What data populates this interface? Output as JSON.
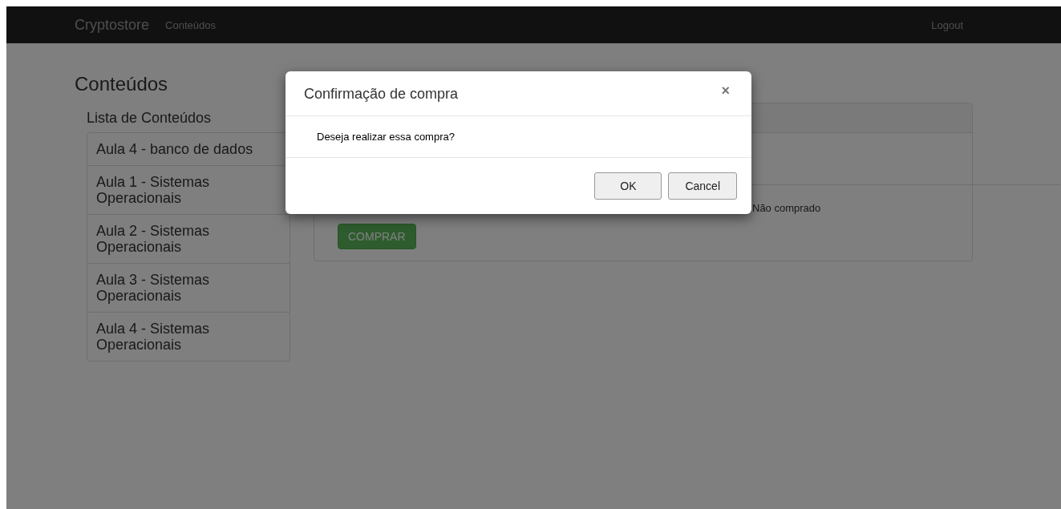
{
  "navbar": {
    "brand": "Cryptostore",
    "links": [
      {
        "label": "Conteúdos"
      }
    ],
    "logout": "Logout"
  },
  "page": {
    "title": "Conteúdos",
    "list_title": "Lista de Conteúdos",
    "items": [
      {
        "label": "Aula 4 - banco de dados"
      },
      {
        "label": "Aula 1 - Sistemas Operacionais"
      },
      {
        "label": "Aula 2 - Sistemas Operacionais"
      },
      {
        "label": "Aula 3 - Sistemas Operacionais"
      },
      {
        "label": "Aula 4 - Sistemas Operacionais"
      }
    ]
  },
  "panel": {
    "status": "Não comprado",
    "buy_button": "COMPRAR"
  },
  "modal": {
    "title": "Confirmação de compra",
    "close": "×",
    "message": "Deseja realizar essa compra?",
    "buttons": [
      "OK",
      "Cancel"
    ]
  }
}
